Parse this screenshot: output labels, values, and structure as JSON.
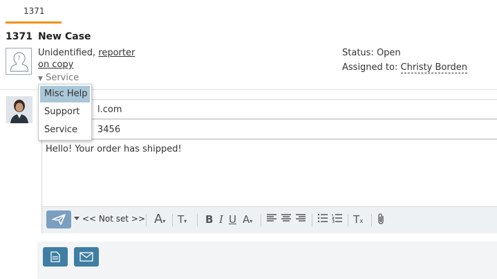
{
  "tab": {
    "label": "1371"
  },
  "case": {
    "number": "1371",
    "title": "New Case"
  },
  "reporter": {
    "prefix": "Unidentified, ",
    "link1": "reporter",
    "link2": "on copy",
    "service_label": "Service"
  },
  "status": {
    "label": "Status: ",
    "value": "Open"
  },
  "assigned": {
    "label": "Assigned to: ",
    "value": "Christy Borden"
  },
  "fields": {
    "email_fragment": "l.com",
    "phone_fragment": "3456"
  },
  "editor": {
    "body": "Hello! Your order has shipped!"
  },
  "toolbar": {
    "not_set": "<< Not set >>"
  },
  "dropdown": {
    "items": [
      "Misc Help",
      "Support",
      "Service"
    ],
    "selected": "Misc Help"
  },
  "colors": {
    "accent": "#f0900f",
    "button": "#3f7ea3",
    "send": "#7b9fc0",
    "selected": "#a9c7d8"
  }
}
